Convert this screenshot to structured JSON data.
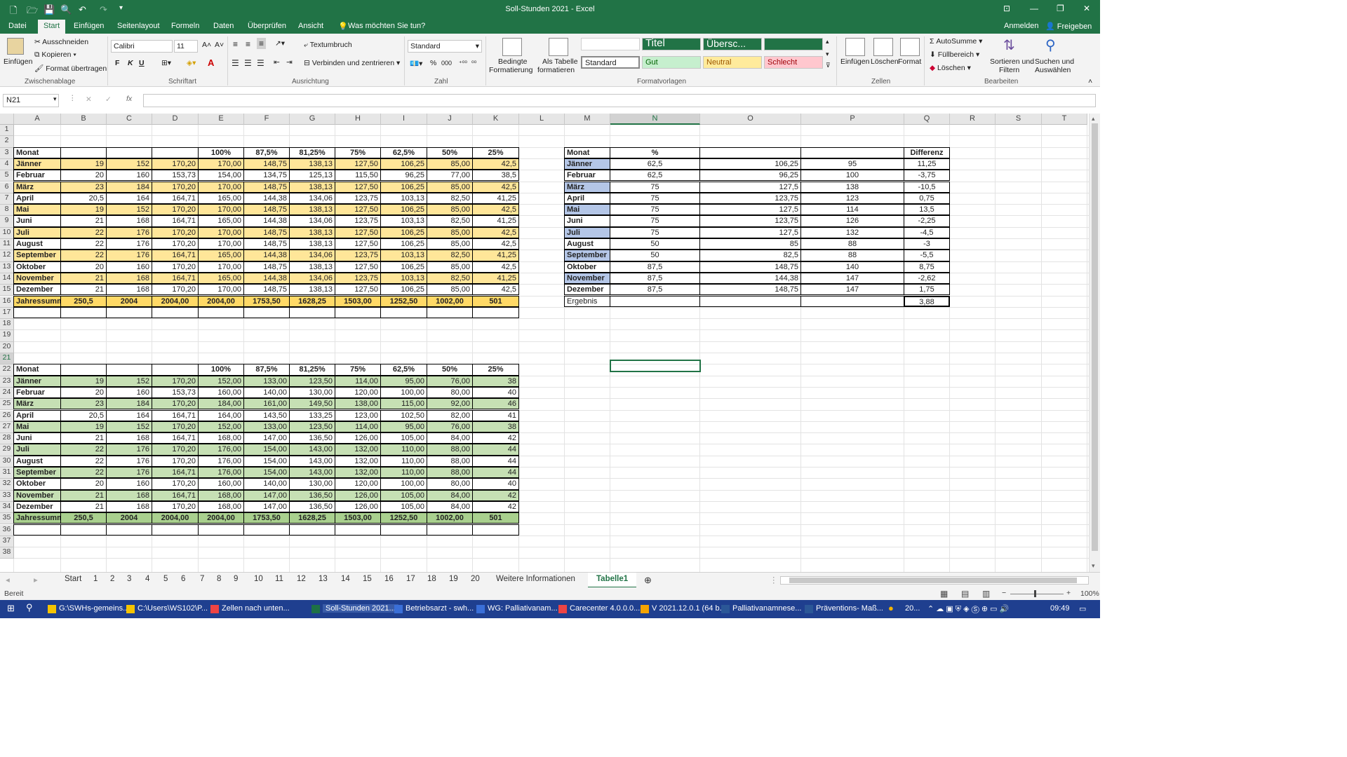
{
  "window": {
    "title": "Soll-Stunden 2021  -  Excel",
    "controls": [
      "⊡",
      "—",
      "❐",
      "✕"
    ]
  },
  "ribbon_tabs": [
    "Datei",
    "Start",
    "Einfügen",
    "Seitenlayout",
    "Formeln",
    "Daten",
    "Überprüfen",
    "Ansicht"
  ],
  "tellme": "Was möchten Sie tun?",
  "account": {
    "signin": "Anmelden",
    "share": "Freigeben"
  },
  "ribbon": {
    "clipboard": {
      "paste": "Einfügen",
      "cut": "Ausschneiden",
      "copy": "Kopieren",
      "format_painter": "Format übertragen",
      "label": "Zwischenablage"
    },
    "font": {
      "name": "Calibri",
      "size": "11",
      "bold": "F",
      "italic": "K",
      "underline": "U",
      "label": "Schriftart"
    },
    "alignment": {
      "wrap": "Textumbruch",
      "merge": "Verbinden und zentrieren",
      "label": "Ausrichtung"
    },
    "number": {
      "format": "Standard",
      "label": "Zahl"
    },
    "styles": {
      "conditional": "Bedingte",
      "conditional2": "Formatierung",
      "as_table": "Als Tabelle",
      "as_table2": "formatieren",
      "titel": "Titel",
      "ueberschrift": "Übersc...",
      "standard": "Standard",
      "gut": "Gut",
      "neutral": "Neutral",
      "schlecht": "Schlecht",
      "label": "Formatvorlagen"
    },
    "cells": {
      "insert": "Einfügen",
      "delete": "Löschen",
      "format": "Format",
      "label": "Zellen"
    },
    "editing": {
      "autosum": "AutoSumme",
      "fill": "Füllbereich",
      "clear": "Löschen",
      "sort": "Sortieren und",
      "sort2": "Filtern",
      "find": "Suchen und",
      "find2": "Auswählen",
      "label": "Bearbeiten"
    }
  },
  "formula_bar": {
    "name_box": "N21",
    "fx": "fx",
    "content": ""
  },
  "columns": [
    "A",
    "B",
    "C",
    "D",
    "E",
    "F",
    "G",
    "H",
    "I",
    "J",
    "K",
    "L",
    "M",
    "N",
    "O",
    "P",
    "Q",
    "R",
    "S",
    "T"
  ],
  "rows": [
    "1",
    "2",
    "3",
    "4",
    "5",
    "6",
    "7",
    "8",
    "9",
    "10",
    "11",
    "12",
    "13",
    "14",
    "15",
    "16",
    "17",
    "18",
    "19",
    "20",
    "21",
    "22",
    "23",
    "24",
    "25",
    "26",
    "27",
    "28",
    "29",
    "30",
    "31",
    "32",
    "33",
    "34",
    "35",
    "36",
    "37",
    "38"
  ],
  "table1": {
    "header": [
      "Monat",
      "",
      "",
      "",
      "100%",
      "87,5%",
      "81,25%",
      "75%",
      "62,5%",
      "50%",
      "25%"
    ],
    "rows": [
      [
        "Jänner",
        "19",
        "152",
        "170,20",
        "170,00",
        "148,75",
        "138,13",
        "127,50",
        "106,25",
        "85,00",
        "42,5"
      ],
      [
        "Februar",
        "20",
        "160",
        "153,73",
        "154,00",
        "134,75",
        "125,13",
        "115,50",
        "96,25",
        "77,00",
        "38,5"
      ],
      [
        "März",
        "23",
        "184",
        "170,20",
        "170,00",
        "148,75",
        "138,13",
        "127,50",
        "106,25",
        "85,00",
        "42,5"
      ],
      [
        "April",
        "20,5",
        "164",
        "164,71",
        "165,00",
        "144,38",
        "134,06",
        "123,75",
        "103,13",
        "82,50",
        "41,25"
      ],
      [
        "Mai",
        "19",
        "152",
        "170,20",
        "170,00",
        "148,75",
        "138,13",
        "127,50",
        "106,25",
        "85,00",
        "42,5"
      ],
      [
        "Juni",
        "21",
        "168",
        "164,71",
        "165,00",
        "144,38",
        "134,06",
        "123,75",
        "103,13",
        "82,50",
        "41,25"
      ],
      [
        "Juli",
        "22",
        "176",
        "170,20",
        "170,00",
        "148,75",
        "138,13",
        "127,50",
        "106,25",
        "85,00",
        "42,5"
      ],
      [
        "August",
        "22",
        "176",
        "170,20",
        "170,00",
        "148,75",
        "138,13",
        "127,50",
        "106,25",
        "85,00",
        "42,5"
      ],
      [
        "September",
        "22",
        "176",
        "164,71",
        "165,00",
        "144,38",
        "134,06",
        "123,75",
        "103,13",
        "82,50",
        "41,25"
      ],
      [
        "Oktober",
        "20",
        "160",
        "170,20",
        "170,00",
        "148,75",
        "138,13",
        "127,50",
        "106,25",
        "85,00",
        "42,5"
      ],
      [
        "November",
        "21",
        "168",
        "164,71",
        "165,00",
        "144,38",
        "134,06",
        "123,75",
        "103,13",
        "82,50",
        "41,25"
      ],
      [
        "Dezember",
        "21",
        "168",
        "170,20",
        "170,00",
        "148,75",
        "138,13",
        "127,50",
        "106,25",
        "85,00",
        "42,5"
      ]
    ],
    "total": [
      "Jahressumm",
      "250,5",
      "2004",
      "2004,00",
      "2004,00",
      "1753,50",
      "1628,25",
      "1503,00",
      "1252,50",
      "1002,00",
      "501"
    ]
  },
  "table2": {
    "header": [
      "Monat",
      "",
      "",
      "",
      "100%",
      "87,5%",
      "81,25%",
      "75%",
      "62,5%",
      "50%",
      "25%"
    ],
    "rows": [
      [
        "Jänner",
        "19",
        "152",
        "170,20",
        "152,00",
        "133,00",
        "123,50",
        "114,00",
        "95,00",
        "76,00",
        "38"
      ],
      [
        "Februar",
        "20",
        "160",
        "153,73",
        "160,00",
        "140,00",
        "130,00",
        "120,00",
        "100,00",
        "80,00",
        "40"
      ],
      [
        "März",
        "23",
        "184",
        "170,20",
        "184,00",
        "161,00",
        "149,50",
        "138,00",
        "115,00",
        "92,00",
        "46"
      ],
      [
        "April",
        "20,5",
        "164",
        "164,71",
        "164,00",
        "143,50",
        "133,25",
        "123,00",
        "102,50",
        "82,00",
        "41"
      ],
      [
        "Mai",
        "19",
        "152",
        "170,20",
        "152,00",
        "133,00",
        "123,50",
        "114,00",
        "95,00",
        "76,00",
        "38"
      ],
      [
        "Juni",
        "21",
        "168",
        "164,71",
        "168,00",
        "147,00",
        "136,50",
        "126,00",
        "105,00",
        "84,00",
        "42"
      ],
      [
        "Juli",
        "22",
        "176",
        "170,20",
        "176,00",
        "154,00",
        "143,00",
        "132,00",
        "110,00",
        "88,00",
        "44"
      ],
      [
        "August",
        "22",
        "176",
        "170,20",
        "176,00",
        "154,00",
        "143,00",
        "132,00",
        "110,00",
        "88,00",
        "44"
      ],
      [
        "September",
        "22",
        "176",
        "164,71",
        "176,00",
        "154,00",
        "143,00",
        "132,00",
        "110,00",
        "88,00",
        "44"
      ],
      [
        "Oktober",
        "20",
        "160",
        "170,20",
        "160,00",
        "140,00",
        "130,00",
        "120,00",
        "100,00",
        "80,00",
        "40"
      ],
      [
        "November",
        "21",
        "168",
        "164,71",
        "168,00",
        "147,00",
        "136,50",
        "126,00",
        "105,00",
        "84,00",
        "42"
      ],
      [
        "Dezember",
        "21",
        "168",
        "170,20",
        "168,00",
        "147,00",
        "136,50",
        "126,00",
        "105,00",
        "84,00",
        "42"
      ]
    ],
    "total": [
      "Jahressumm",
      "250,5",
      "2004",
      "2004,00",
      "2004,00",
      "1753,50",
      "1628,25",
      "1503,00",
      "1252,50",
      "1002,00",
      "501"
    ]
  },
  "table3": {
    "header": [
      "Monat",
      "%",
      "",
      "",
      "Differenz"
    ],
    "rows": [
      [
        "Jänner",
        "62,5",
        "106,25",
        "95",
        "11,25"
      ],
      [
        "Februar",
        "62,5",
        "96,25",
        "100",
        "-3,75"
      ],
      [
        "März",
        "75",
        "127,5",
        "138",
        "-10,5"
      ],
      [
        "April",
        "75",
        "123,75",
        "123",
        "0,75"
      ],
      [
        "Mai",
        "75",
        "127,5",
        "114",
        "13,5"
      ],
      [
        "Juni",
        "75",
        "123,75",
        "126",
        "-2,25"
      ],
      [
        "Juli",
        "75",
        "127,5",
        "132",
        "-4,5"
      ],
      [
        "August",
        "50",
        "85",
        "88",
        "-3"
      ],
      [
        "September",
        "50",
        "82,5",
        "88",
        "-5,5"
      ],
      [
        "Oktober",
        "87,5",
        "148,75",
        "140",
        "8,75"
      ],
      [
        "November",
        "87,5",
        "144,38",
        "147",
        "-2,62"
      ],
      [
        "Dezember",
        "87,5",
        "148,75",
        "147",
        "1,75"
      ]
    ],
    "result": [
      "Ergebnis",
      "",
      "",
      "",
      "3,88"
    ]
  },
  "sheet_tabs": [
    "Start",
    "1",
    "2",
    "3",
    "4",
    "5",
    "6",
    "7",
    "8",
    "9",
    "10",
    "11",
    "12",
    "13",
    "14",
    "15",
    "16",
    "17",
    "18",
    "19",
    "20",
    "Weitere Informationen",
    "Tabelle1"
  ],
  "status": {
    "ready": "Bereit",
    "zoom": "100%"
  },
  "taskbar": {
    "items": [
      "G:\\SWHs-gemeins...",
      "C:\\Users\\WS102\\P...",
      "Zellen nach unten...",
      "Soll-Stunden 2021...",
      "Betriebsarzt - swh...",
      "WG: Palliativanam...",
      "Carecenter 4.0.0.0...",
      "V 2021.12.0.1 (64 b...",
      "Palliativanamnese...",
      "Präventions- Maß..."
    ],
    "weather": "20...",
    "time": "09:49"
  }
}
